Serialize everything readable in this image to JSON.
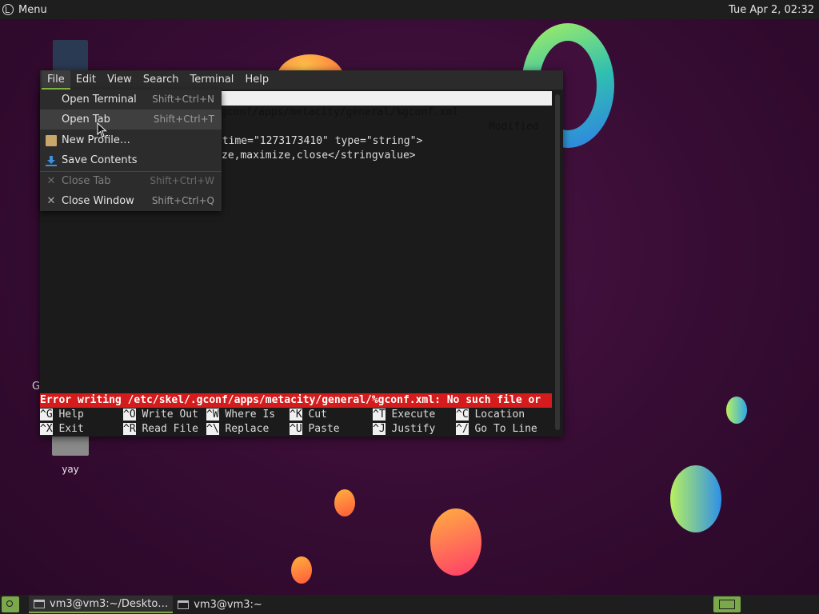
{
  "top_panel": {
    "menu_label": "Menu",
    "clock": "Tue Apr  2, 02:32"
  },
  "desktop": {
    "icon_label": "yay",
    "stray_letter": "G"
  },
  "terminal": {
    "menubar": [
      "File",
      "Edit",
      "View",
      "Search",
      "Terminal",
      "Help"
    ],
    "nano_title_path": "gconf/apps/metacity/general/%gconf.xml",
    "nano_title_status": "Modified",
    "content_lines": [
      "ntime=\"1273173410\" type=\"string\">",
      "ze,maximize,close</stringvalue>"
    ],
    "error_message": "Error writing /etc/skel/.gconf/apps/metacity/general/%gconf.xml: No such file or",
    "shortcuts_row1": [
      {
        "key": "^G",
        "label": "Help"
      },
      {
        "key": "^O",
        "label": "Write Out"
      },
      {
        "key": "^W",
        "label": "Where Is"
      },
      {
        "key": "^K",
        "label": "Cut"
      },
      {
        "key": "^T",
        "label": "Execute"
      },
      {
        "key": "^C",
        "label": "Location"
      }
    ],
    "shortcuts_row2": [
      {
        "key": "^X",
        "label": "Exit"
      },
      {
        "key": "^R",
        "label": "Read File"
      },
      {
        "key": "^\\",
        "label": "Replace"
      },
      {
        "key": "^U",
        "label": "Paste"
      },
      {
        "key": "^J",
        "label": "Justify"
      },
      {
        "key": "^/",
        "label": "Go To Line"
      }
    ]
  },
  "file_menu": {
    "open_terminal": {
      "label": "Open Terminal",
      "accel": "Shift+Ctrl+N"
    },
    "open_tab": {
      "label": "Open Tab",
      "accel": "Shift+Ctrl+T"
    },
    "new_profile": {
      "label": "New Profile…"
    },
    "save_contents": {
      "label": "Save Contents"
    },
    "close_tab": {
      "label": "Close Tab",
      "accel": "Shift+Ctrl+W"
    },
    "close_window": {
      "label": "Close Window",
      "accel": "Shift+Ctrl+Q"
    }
  },
  "taskbar": {
    "tasks": [
      "vm3@vm3:~/Deskto…",
      "vm3@vm3:~"
    ]
  },
  "colors": {
    "accent": "#7aa84a",
    "error_bar": "#d41c1c"
  }
}
